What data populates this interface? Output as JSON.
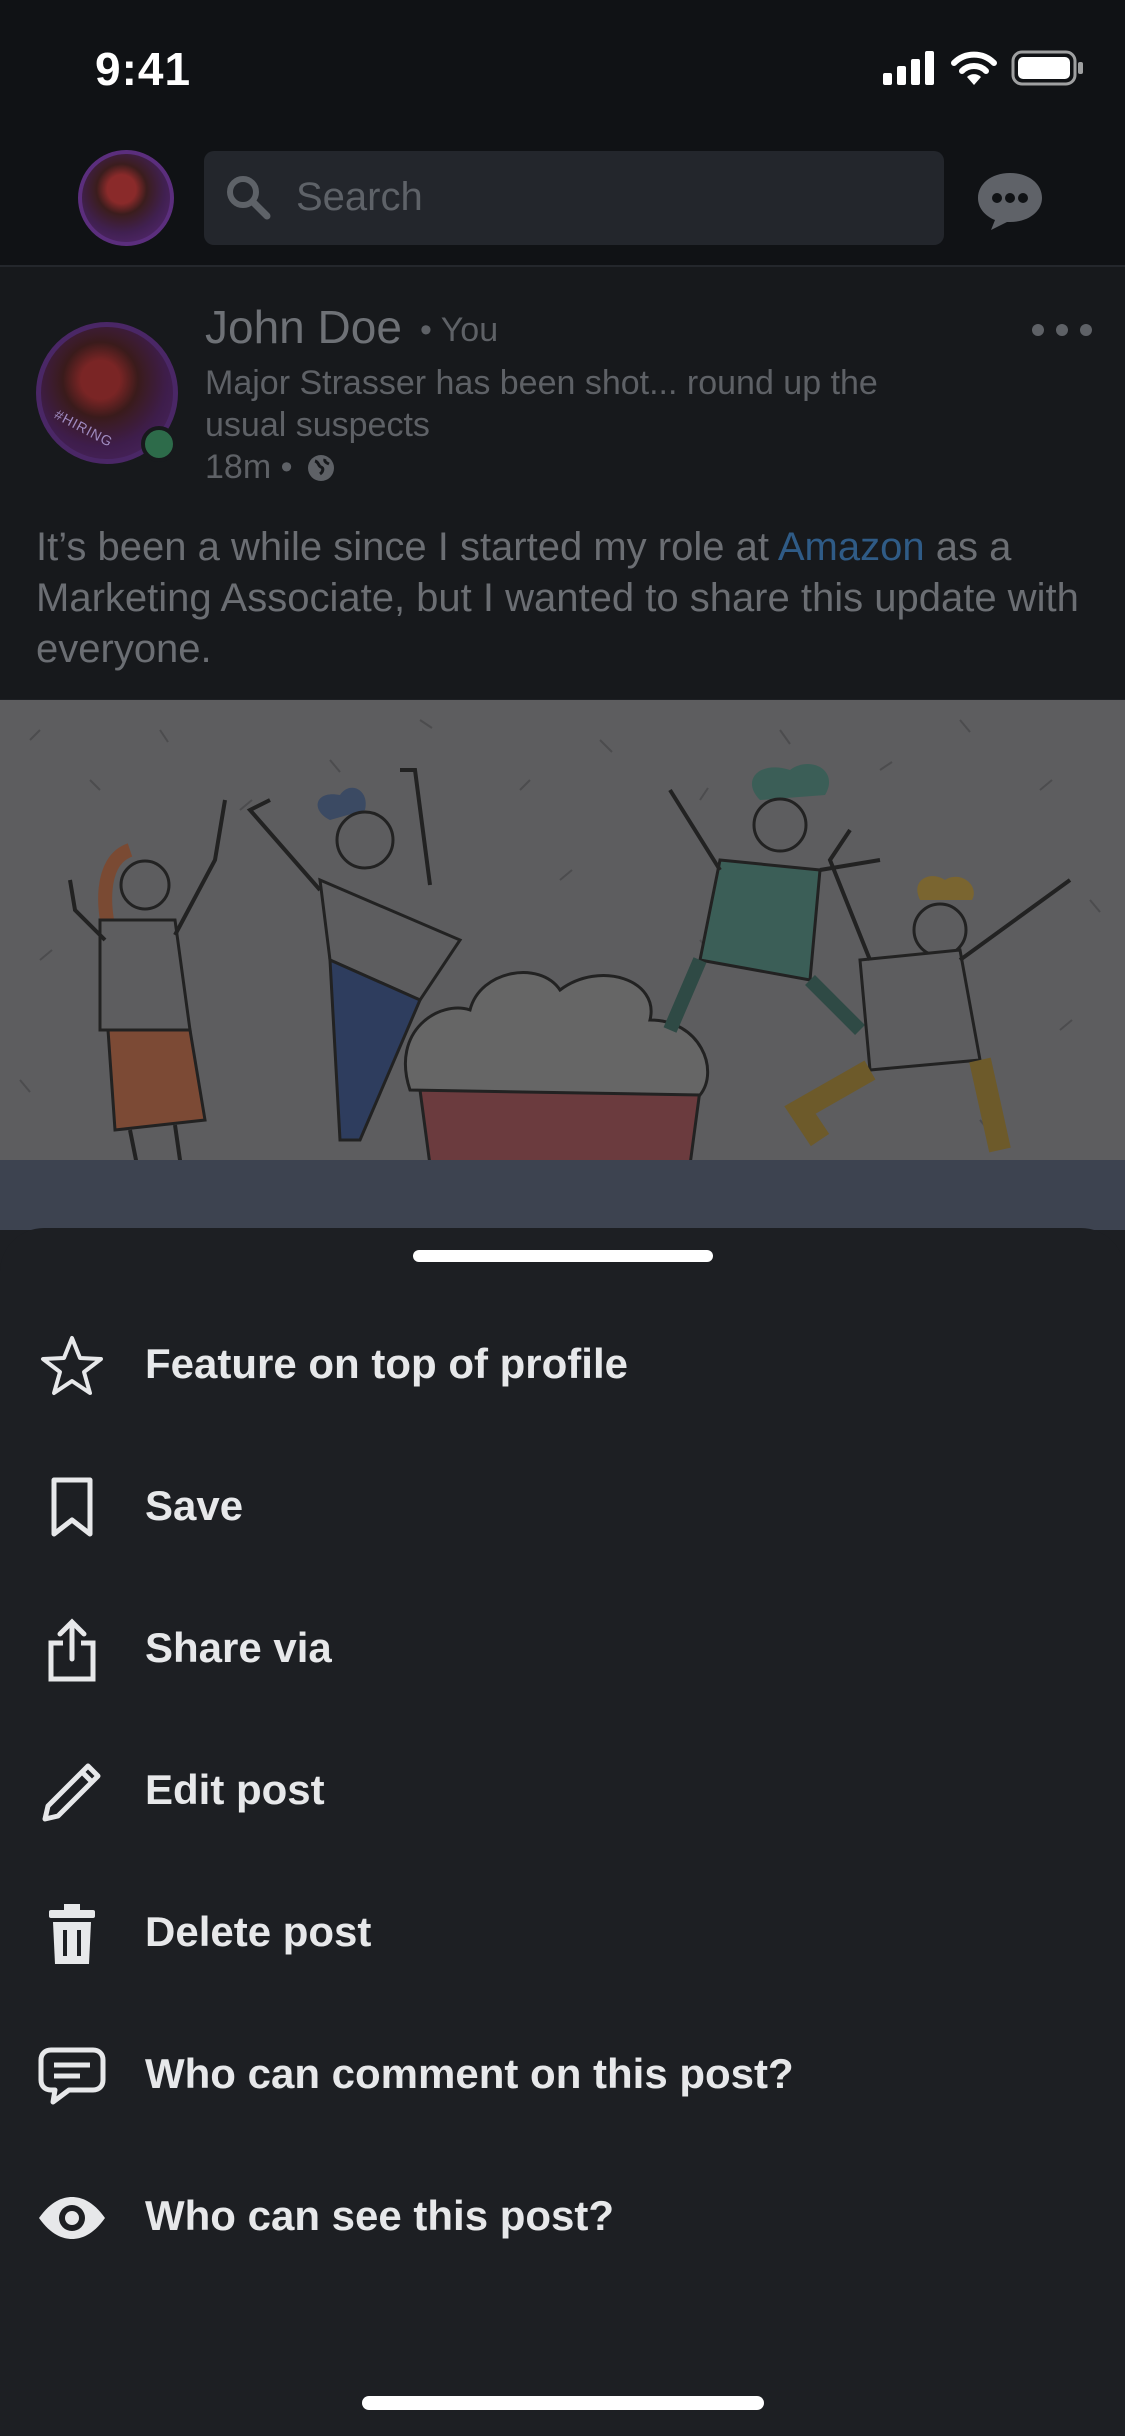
{
  "status_bar": {
    "time": "9:41"
  },
  "header": {
    "search_placeholder": "Search"
  },
  "post": {
    "author": "John Doe",
    "relation": "• You",
    "headline": "Major Strasser has been shot... round up the usual suspects",
    "time": "18m •",
    "hiring_badge": "#HIRING",
    "text_before": "It’s been a while since I started my role at ",
    "company": "Amazon",
    "text_after": " as a Marketing Associate, but I wanted to share this update with everyone."
  },
  "menu": {
    "items": [
      {
        "label": "Feature on top of profile",
        "icon": "star-icon"
      },
      {
        "label": "Save",
        "icon": "bookmark-icon"
      },
      {
        "label": "Share via",
        "icon": "share-icon"
      },
      {
        "label": "Edit post",
        "icon": "pencil-icon"
      },
      {
        "label": "Delete post",
        "icon": "trash-icon"
      },
      {
        "label": "Who can comment on this post?",
        "icon": "comment-icon"
      },
      {
        "label": "Who can see this post?",
        "icon": "eye-icon"
      }
    ]
  },
  "colors": {
    "accent": "#2f5b86",
    "online": "#2d6b4a",
    "sheet_bg": "#1d1f23"
  }
}
